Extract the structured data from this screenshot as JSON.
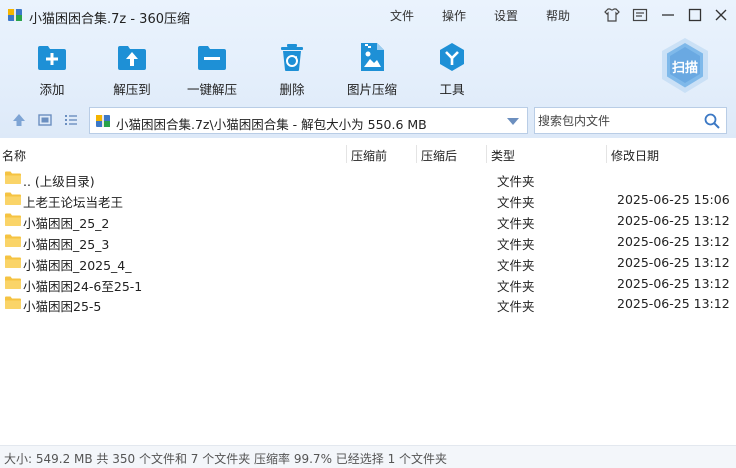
{
  "window": {
    "title": "小猫困困合集.7z - 360压缩",
    "menus": [
      "文件",
      "操作",
      "设置",
      "帮助"
    ]
  },
  "toolbar": {
    "add": "添加",
    "extract_to": "解压到",
    "one_click": "一键解压",
    "delete": "删除",
    "image_compress": "图片压缩",
    "tools": "工具",
    "scan": "扫描"
  },
  "navbar": {
    "address": "小猫困困合集.7z\\小猫困困合集 - 解包大小为 550.6 MB",
    "search_placeholder": "搜索包内文件"
  },
  "columns": {
    "name": "名称",
    "compressed_before": "压缩前",
    "compressed_after": "压缩后",
    "type": "类型",
    "modified": "修改日期"
  },
  "files": [
    {
      "name": ".. (上级目录)",
      "type": "文件夹",
      "date": ""
    },
    {
      "name": "上老王论坛当老王",
      "type": "文件夹",
      "date": "2025-06-25 15:06"
    },
    {
      "name": "小猫困困_25_2",
      "type": "文件夹",
      "date": "2025-06-25 13:12"
    },
    {
      "name": "小猫困困_25_3",
      "type": "文件夹",
      "date": "2025-06-25 13:12"
    },
    {
      "name": "小猫困困_2025_4_",
      "type": "文件夹",
      "date": "2025-06-25 13:12"
    },
    {
      "name": "小猫困困24-6至25-1",
      "type": "文件夹",
      "date": "2025-06-25 13:12"
    },
    {
      "name": "小猫困困25-5",
      "type": "文件夹",
      "date": "2025-06-25 13:12"
    }
  ],
  "status": {
    "text": "大小: 549.2 MB 共 350 个文件和 7 个文件夹 压缩率 99.7% 已经选择 1 个文件夹"
  },
  "colors": {
    "accent": "#1e90d6",
    "folder": "#f5c342",
    "chrome_bg": "#e3eefb"
  }
}
